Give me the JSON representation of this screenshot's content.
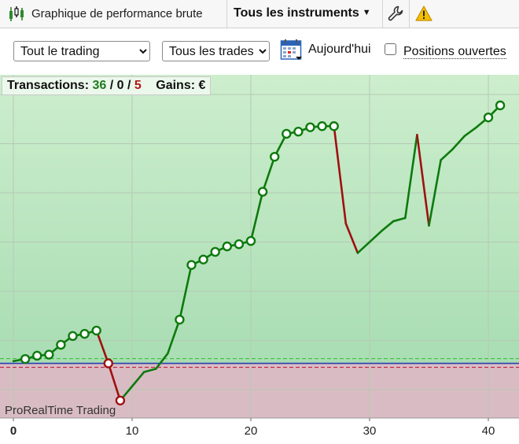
{
  "toolbar": {
    "title": "Graphique de performance brute",
    "instruments": "Tous les instruments",
    "chart_icon": "candlestick-chart-icon",
    "settings_icon": "wrench-icon",
    "warning_icon": "warning-icon",
    "warning_color": "#f2c000"
  },
  "filters": {
    "scope": "Tout le trading",
    "trades": "Tous les trades",
    "calendar_icon": "calendar-icon",
    "today": "Aujourd'hui",
    "open_positions": "Positions ouvertes",
    "open_positions_checked": false
  },
  "stats": {
    "label": "Transactions:",
    "wins": "36",
    "sep1": "/",
    "neutral": "0",
    "sep2": "/",
    "losses": "5",
    "gains_label": "Gains: €"
  },
  "watermark": "ProRealTime Trading",
  "colors": {
    "win": "#0d7a0d",
    "loss": "#a01010",
    "profit_zone": "#c6ebc6",
    "loss_zone": "#d9bcc3"
  },
  "chart_data": {
    "type": "line",
    "x_ticks": [
      "0",
      "10",
      "20",
      "30",
      "40"
    ],
    "xlim": [
      -1,
      42
    ],
    "ylim": [
      -2.5,
      13.2
    ],
    "zero_level": 0,
    "points": [
      {
        "x": 0,
        "y": 0.1,
        "m": false
      },
      {
        "x": 1,
        "y": 0.2,
        "m": true
      },
      {
        "x": 2,
        "y": 0.35,
        "m": true
      },
      {
        "x": 3,
        "y": 0.4,
        "m": true
      },
      {
        "x": 4,
        "y": 0.85,
        "m": true
      },
      {
        "x": 5,
        "y": 1.25,
        "m": true
      },
      {
        "x": 6,
        "y": 1.35,
        "m": true
      },
      {
        "x": 7,
        "y": 1.5,
        "m": true
      },
      {
        "x": 8,
        "y": 0.0,
        "m": true
      },
      {
        "x": 9,
        "y": -1.7,
        "m": true
      },
      {
        "x": 10,
        "y": -1.05,
        "m": false
      },
      {
        "x": 11,
        "y": -0.4,
        "m": false
      },
      {
        "x": 12,
        "y": -0.25,
        "m": false
      },
      {
        "x": 13,
        "y": 0.45,
        "m": false
      },
      {
        "x": 14,
        "y": 2.0,
        "m": true
      },
      {
        "x": 15,
        "y": 4.5,
        "m": true
      },
      {
        "x": 16,
        "y": 4.75,
        "m": true
      },
      {
        "x": 17,
        "y": 5.1,
        "m": true
      },
      {
        "x": 18,
        "y": 5.35,
        "m": true
      },
      {
        "x": 19,
        "y": 5.45,
        "m": true
      },
      {
        "x": 20,
        "y": 5.6,
        "m": true
      },
      {
        "x": 21,
        "y": 7.85,
        "m": true
      },
      {
        "x": 22,
        "y": 9.45,
        "m": true
      },
      {
        "x": 23,
        "y": 10.5,
        "m": true
      },
      {
        "x": 24,
        "y": 10.6,
        "m": true
      },
      {
        "x": 25,
        "y": 10.8,
        "m": true
      },
      {
        "x": 26,
        "y": 10.85,
        "m": true
      },
      {
        "x": 27,
        "y": 10.85,
        "m": true
      },
      {
        "x": 28,
        "y": 6.4,
        "m": false
      },
      {
        "x": 29,
        "y": 5.05,
        "m": false
      },
      {
        "x": 30,
        "y": 5.55,
        "m": false
      },
      {
        "x": 31,
        "y": 6.05,
        "m": false
      },
      {
        "x": 32,
        "y": 6.5,
        "m": false
      },
      {
        "x": 33,
        "y": 6.65,
        "m": false
      },
      {
        "x": 34,
        "y": 10.45,
        "m": false
      },
      {
        "x": 35,
        "y": 6.3,
        "m": false
      },
      {
        "x": 36,
        "y": 9.3,
        "m": false
      },
      {
        "x": 37,
        "y": 9.8,
        "m": false
      },
      {
        "x": 38,
        "y": 10.4,
        "m": false
      },
      {
        "x": 39,
        "y": 10.8,
        "m": false
      },
      {
        "x": 40,
        "y": 11.25,
        "m": true
      },
      {
        "x": 41,
        "y": 11.8,
        "m": true
      }
    ]
  }
}
